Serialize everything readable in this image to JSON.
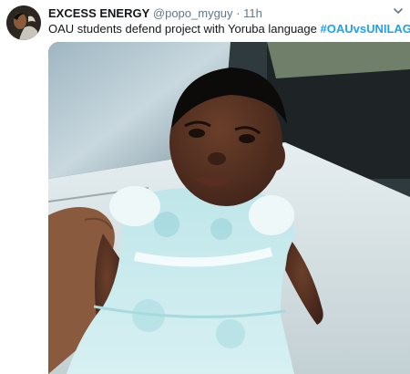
{
  "tweet": {
    "author_name": "EXCESS ENERGY",
    "handle": "@popo_myguy",
    "separator": "·",
    "time": "11h",
    "text": "OAU students defend project with Yoruba language",
    "hashtag": "#OAUvsUNILAG",
    "menu_icon": "chevron-down-icon",
    "avatar_icon": "avatar",
    "media_icon": "photo"
  },
  "colors": {
    "name": "#14171a",
    "muted": "#657786",
    "hashtag": "#1da1f2"
  }
}
